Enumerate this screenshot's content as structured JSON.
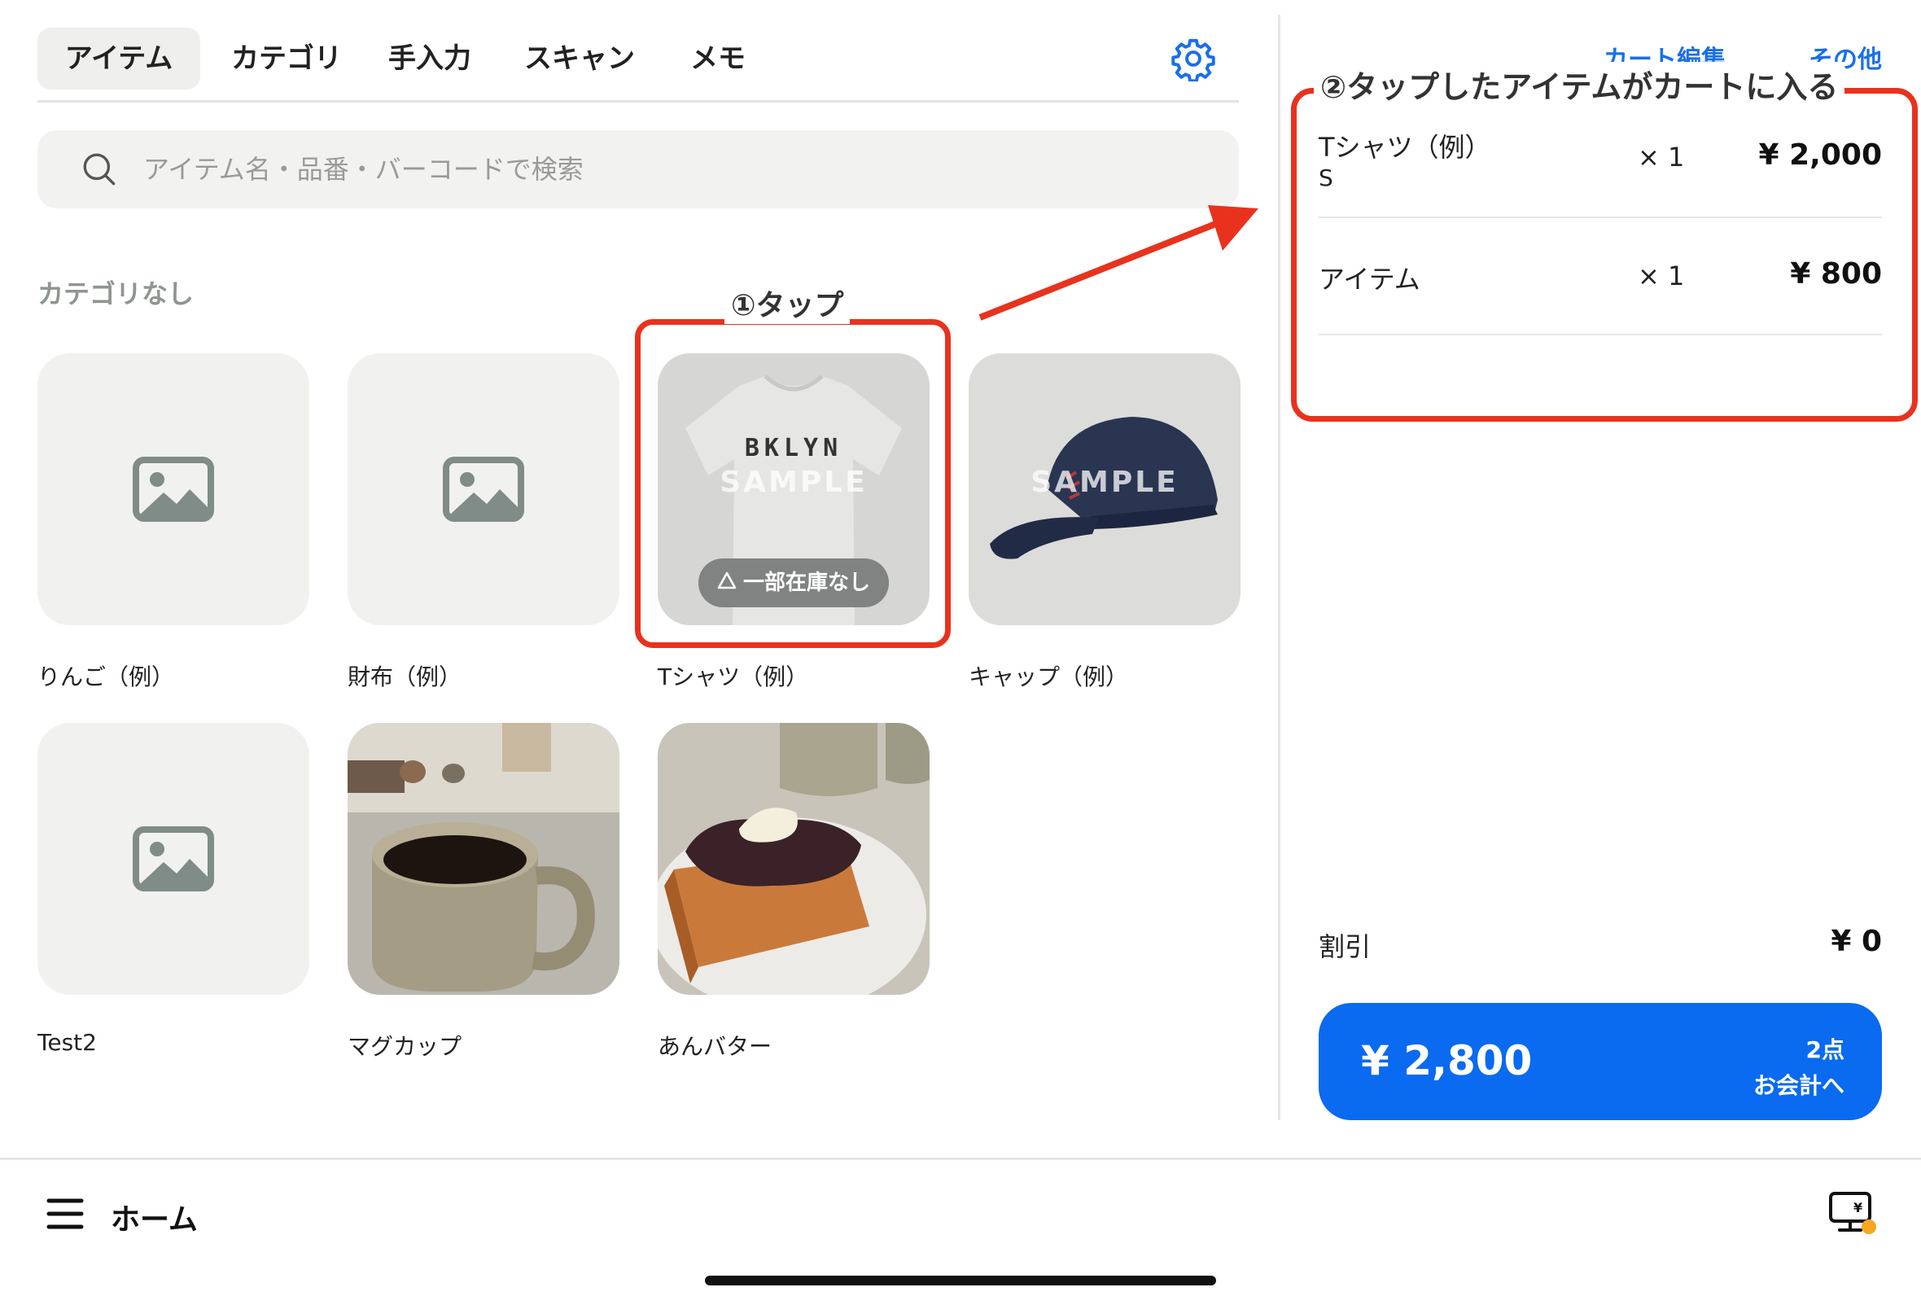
{
  "tabs": [
    {
      "label": "アイテム",
      "active": true
    },
    {
      "label": "カテゴリ",
      "active": false
    },
    {
      "label": "手入力",
      "active": false
    },
    {
      "label": "スキャン",
      "active": false
    },
    {
      "label": "メモ",
      "active": false
    }
  ],
  "search": {
    "placeholder": "アイテム名・品番・バーコードで検索"
  },
  "category_heading": "カテゴリなし",
  "items": [
    {
      "name": "りんご（例）",
      "image": "placeholder-image-icon"
    },
    {
      "name": "財布（例）",
      "image": "placeholder-image-icon"
    },
    {
      "name": "Tシャツ（例）",
      "image": "tshirt-photo",
      "badge": "一部在庫なし",
      "print": "BKLYN",
      "watermark": "SAMPLE"
    },
    {
      "name": "キャップ（例）",
      "image": "cap-photo",
      "watermark": "SAMPLE"
    },
    {
      "name": "Test2",
      "image": "placeholder-image-icon"
    },
    {
      "name": "マグカップ",
      "image": "mug-photo"
    },
    {
      "name": "あんバター",
      "image": "anbutter-toast-photo"
    }
  ],
  "annotations": {
    "step1": "①タップ",
    "step2": "②タップしたアイテムがカートに入る",
    "color": "#e8321e"
  },
  "cart": {
    "edit_label": "カート編集",
    "more_label": "その他",
    "lines": [
      {
        "name": "Tシャツ（例）",
        "variant": "S",
        "qty": "× 1",
        "price": "¥ 2,000"
      },
      {
        "name": "アイテム",
        "qty": "× 1",
        "price": "¥ 800"
      }
    ],
    "discount_label": "割引",
    "discount_value": "¥ 0",
    "total": "¥ 2,800",
    "count": "2点",
    "checkout_label": "お会計へ"
  },
  "bottom_bar": {
    "menu_icon": "hamburger-icon",
    "title": "ホーム",
    "register_icon": "register-display-icon"
  },
  "colors": {
    "accent": "#0a6af0",
    "link": "#1a6fe8",
    "annotation": "#e8321e"
  }
}
